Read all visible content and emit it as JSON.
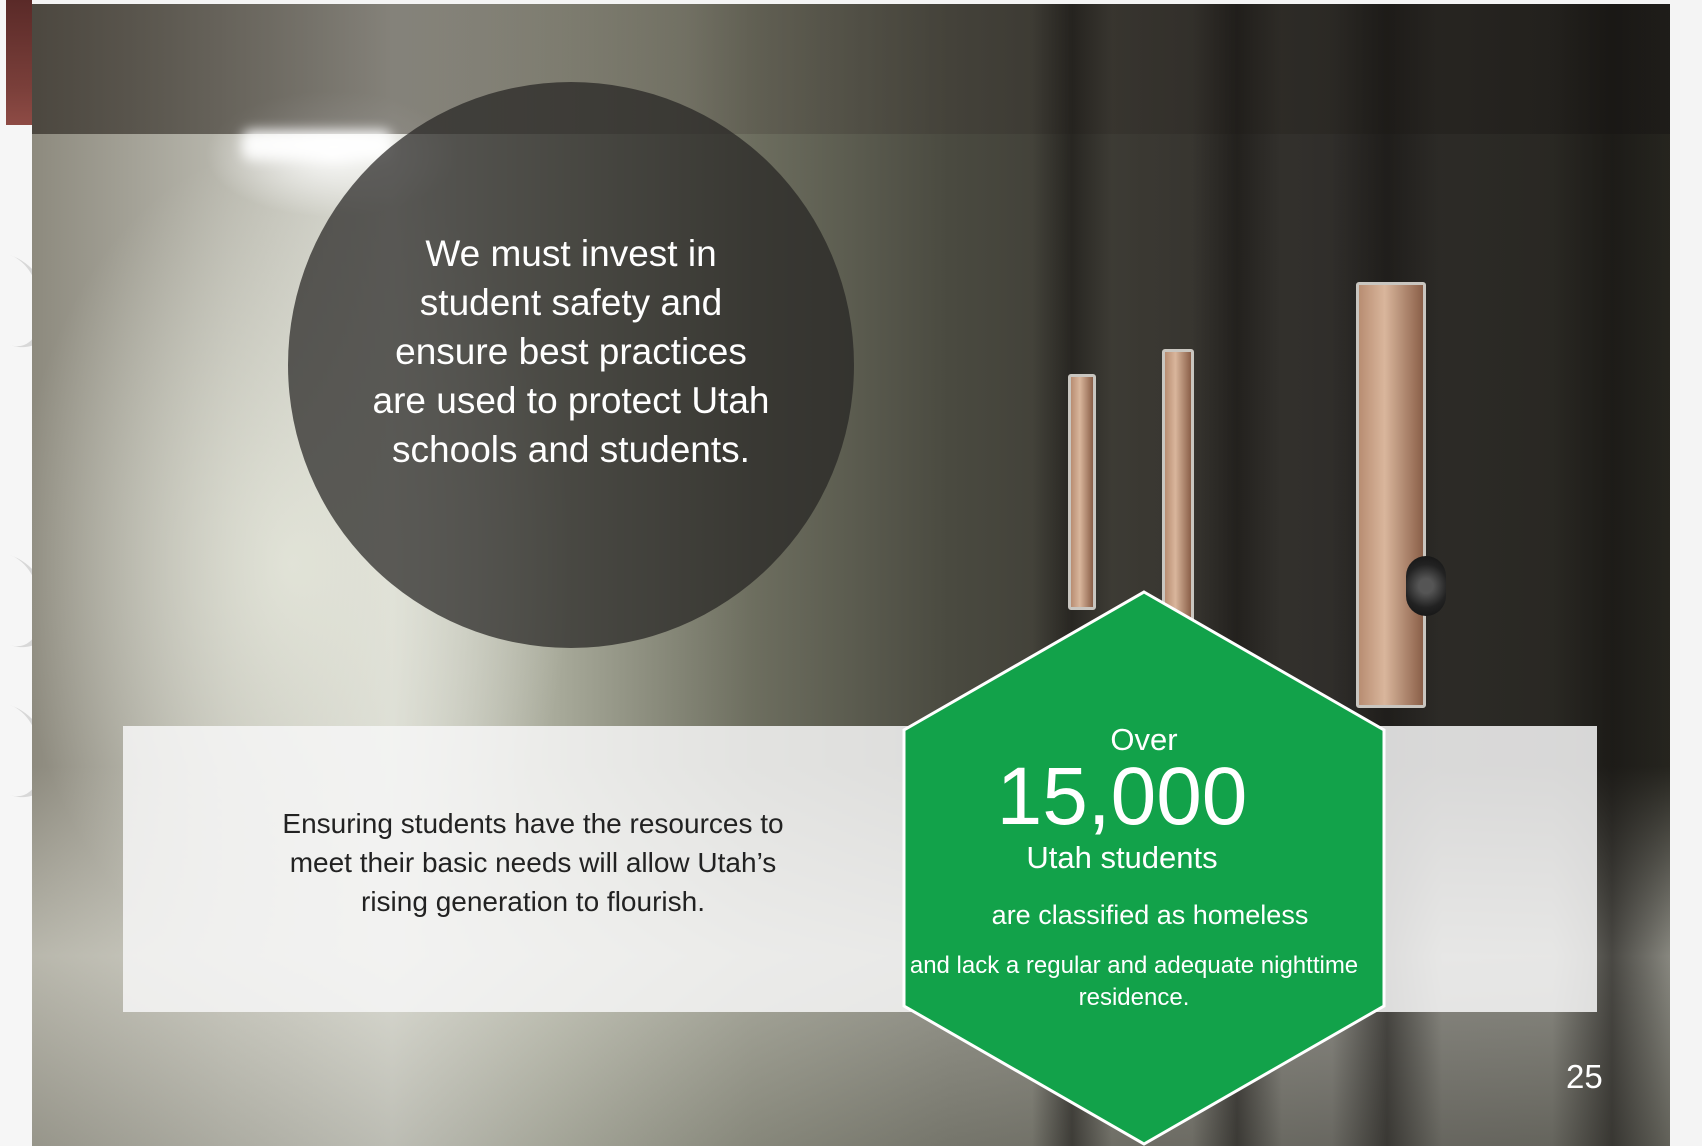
{
  "quote": "We must invest in student safety and ensure best practices are used to protect Utah schools and students.",
  "band": {
    "text": "Ensuring students have the resources to meet their basic needs will allow Utah’s rising generation to flourish."
  },
  "stat": {
    "over": "Over",
    "number": "15,000",
    "subject": "Utah students",
    "classified": "are classified as homeless",
    "detail": "and lack a regular and adequate nighttime residence.",
    "color": "#12a24a"
  },
  "page_number": "25"
}
